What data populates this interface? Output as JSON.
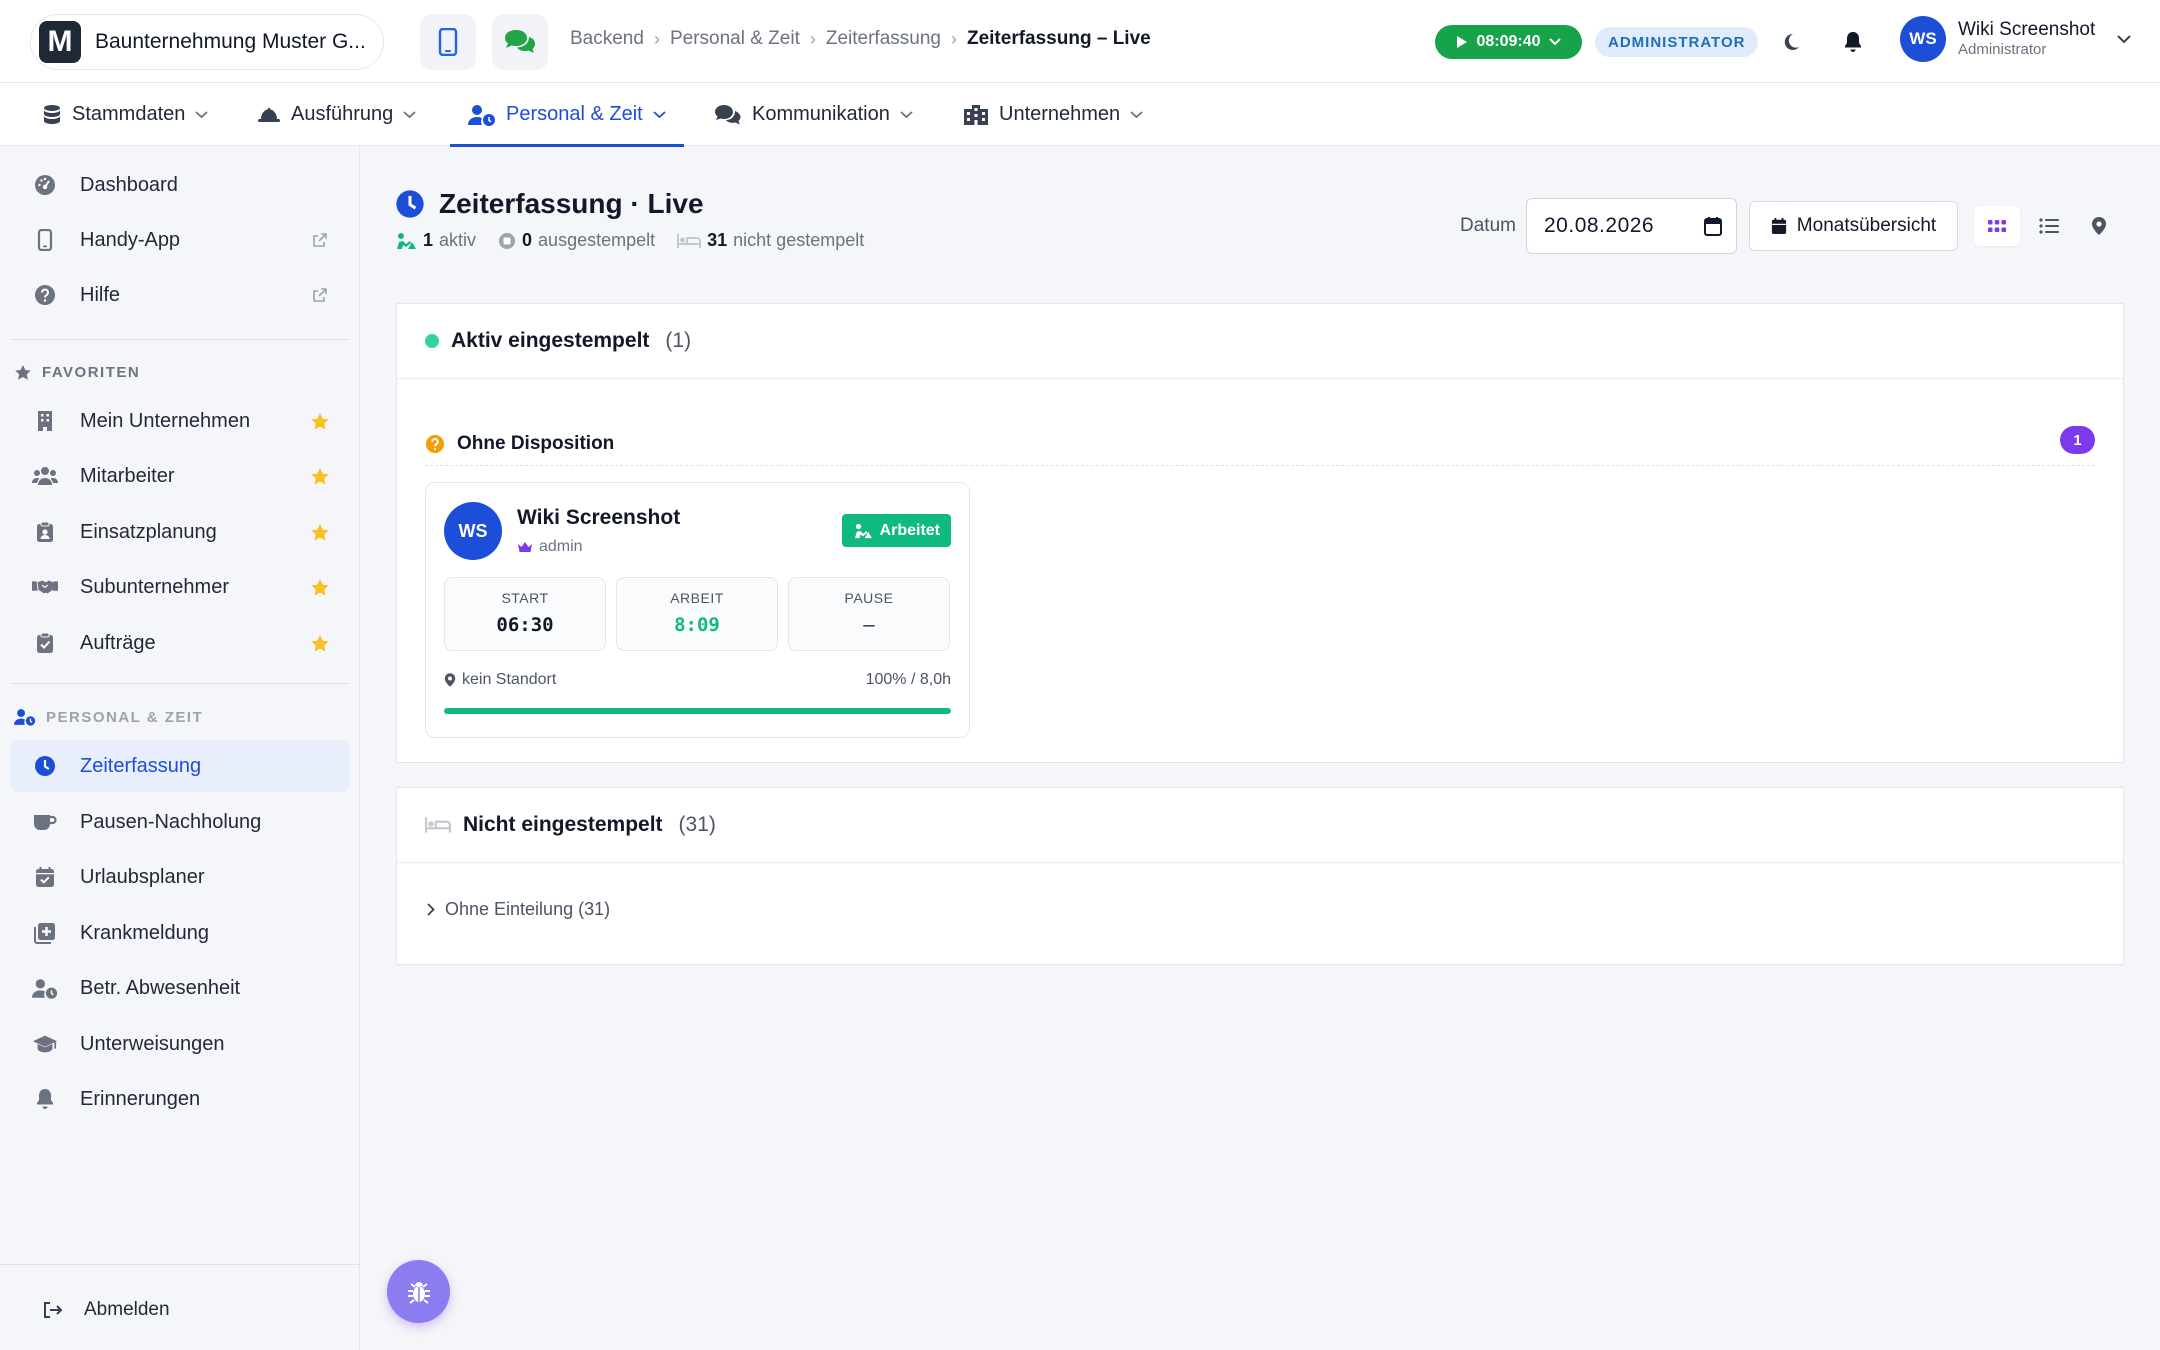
{
  "brand": {
    "name": "Baunternehmung Muster G..."
  },
  "breadcrumb": {
    "items": [
      "Backend",
      "Personal & Zeit",
      "Zeiterfassung"
    ],
    "current": "Zeiterfassung – Live"
  },
  "topbar": {
    "timer": "08:09:40",
    "role": "ADMINISTRATOR",
    "user_initials": "WS",
    "user_name": "Wiki Screenshot",
    "user_role": "Administrator"
  },
  "mainnav": [
    {
      "label": "Stammdaten",
      "icon": "database-icon"
    },
    {
      "label": "Ausführung",
      "icon": "helmet-icon"
    },
    {
      "label": "Personal & Zeit",
      "icon": "user-clock-icon",
      "active": true
    },
    {
      "label": "Kommunikation",
      "icon": "comments-icon"
    },
    {
      "label": "Unternehmen",
      "icon": "building-icon"
    }
  ],
  "sidebar": {
    "top": [
      {
        "label": "Dashboard",
        "icon": "gauge-icon"
      },
      {
        "label": "Handy-App",
        "icon": "mobile-icon",
        "external": true
      },
      {
        "label": "Hilfe",
        "icon": "question-icon",
        "external": true
      }
    ],
    "favorites_title": "FAVORITEN",
    "favorites": [
      {
        "label": "Mein Unternehmen",
        "icon": "building-icon"
      },
      {
        "label": "Mitarbeiter",
        "icon": "users-icon"
      },
      {
        "label": "Einsatzplanung",
        "icon": "clipboard-user-icon"
      },
      {
        "label": "Subunternehmer",
        "icon": "handshake-icon"
      },
      {
        "label": "Aufträge",
        "icon": "clipboard-check-icon"
      }
    ],
    "section_title": "PERSONAL & ZEIT",
    "section": [
      {
        "label": "Zeiterfassung",
        "icon": "clock-icon",
        "active": true
      },
      {
        "label": "Pausen-Nachholung",
        "icon": "coffee-icon"
      },
      {
        "label": "Urlaubsplaner",
        "icon": "calendar-check-icon"
      },
      {
        "label": "Krankmeldung",
        "icon": "medical-icon"
      },
      {
        "label": "Betr. Abwesenheit",
        "icon": "user-clock-icon"
      },
      {
        "label": "Unterweisungen",
        "icon": "graduation-cap-icon"
      },
      {
        "label": "Erinnerungen",
        "icon": "bell-icon"
      }
    ],
    "logout": "Abmelden"
  },
  "page": {
    "title": "Zeiterfassung · Live",
    "stats": {
      "active_count": "1",
      "active_label": "aktiv",
      "out_count": "0",
      "out_label": "ausgestempelt",
      "none_count": "31",
      "none_label": "nicht gestempelt"
    },
    "date_label": "Datum",
    "date_value": "20.08.2026",
    "month_button": "Monatsübersicht"
  },
  "active_card": {
    "title": "Aktiv eingestempelt",
    "count": "(1)",
    "group_title": "Ohne Disposition",
    "group_badge": "1",
    "employee": {
      "initials": "WS",
      "name": "Wiki Screenshot",
      "role": "admin",
      "status": "Arbeitet",
      "start_label": "START",
      "start": "06:30",
      "work_label": "ARBEIT",
      "work": "8:09",
      "pause_label": "PAUSE",
      "pause": "–",
      "location": "kein Standort",
      "percent_text": "100% / 8,0h",
      "progress": 1.0
    }
  },
  "inactive_card": {
    "title": "Nicht eingestempelt",
    "count": "(31)",
    "group": "Ohne Einteilung (31)"
  },
  "colors": {
    "primary": "#1d4ed8",
    "success": "#10b981",
    "timer": "#16a34a",
    "badge": "#7c3aed",
    "warning": "#f59e0b",
    "fab": "#8b7cf0"
  }
}
